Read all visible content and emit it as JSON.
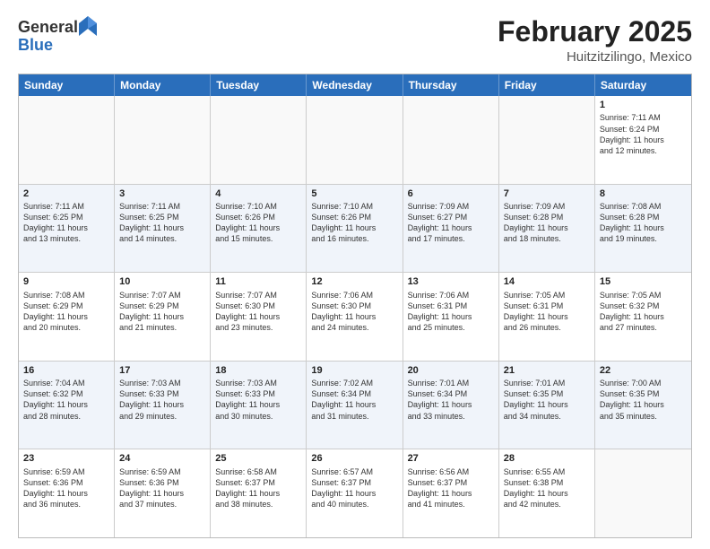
{
  "header": {
    "logo_line1": "General",
    "logo_line2": "Blue",
    "month_title": "February 2025",
    "location": "Huitzitzilingo, Mexico"
  },
  "days_of_week": [
    "Sunday",
    "Monday",
    "Tuesday",
    "Wednesday",
    "Thursday",
    "Friday",
    "Saturday"
  ],
  "weeks": [
    {
      "alt": false,
      "cells": [
        {
          "day": "",
          "empty": true,
          "lines": []
        },
        {
          "day": "",
          "empty": true,
          "lines": []
        },
        {
          "day": "",
          "empty": true,
          "lines": []
        },
        {
          "day": "",
          "empty": true,
          "lines": []
        },
        {
          "day": "",
          "empty": true,
          "lines": []
        },
        {
          "day": "",
          "empty": true,
          "lines": []
        },
        {
          "day": "1",
          "empty": false,
          "lines": [
            "Sunrise: 7:11 AM",
            "Sunset: 6:24 PM",
            "Daylight: 11 hours",
            "and 12 minutes."
          ]
        }
      ]
    },
    {
      "alt": true,
      "cells": [
        {
          "day": "2",
          "empty": false,
          "lines": [
            "Sunrise: 7:11 AM",
            "Sunset: 6:25 PM",
            "Daylight: 11 hours",
            "and 13 minutes."
          ]
        },
        {
          "day": "3",
          "empty": false,
          "lines": [
            "Sunrise: 7:11 AM",
            "Sunset: 6:25 PM",
            "Daylight: 11 hours",
            "and 14 minutes."
          ]
        },
        {
          "day": "4",
          "empty": false,
          "lines": [
            "Sunrise: 7:10 AM",
            "Sunset: 6:26 PM",
            "Daylight: 11 hours",
            "and 15 minutes."
          ]
        },
        {
          "day": "5",
          "empty": false,
          "lines": [
            "Sunrise: 7:10 AM",
            "Sunset: 6:26 PM",
            "Daylight: 11 hours",
            "and 16 minutes."
          ]
        },
        {
          "day": "6",
          "empty": false,
          "lines": [
            "Sunrise: 7:09 AM",
            "Sunset: 6:27 PM",
            "Daylight: 11 hours",
            "and 17 minutes."
          ]
        },
        {
          "day": "7",
          "empty": false,
          "lines": [
            "Sunrise: 7:09 AM",
            "Sunset: 6:28 PM",
            "Daylight: 11 hours",
            "and 18 minutes."
          ]
        },
        {
          "day": "8",
          "empty": false,
          "lines": [
            "Sunrise: 7:08 AM",
            "Sunset: 6:28 PM",
            "Daylight: 11 hours",
            "and 19 minutes."
          ]
        }
      ]
    },
    {
      "alt": false,
      "cells": [
        {
          "day": "9",
          "empty": false,
          "lines": [
            "Sunrise: 7:08 AM",
            "Sunset: 6:29 PM",
            "Daylight: 11 hours",
            "and 20 minutes."
          ]
        },
        {
          "day": "10",
          "empty": false,
          "lines": [
            "Sunrise: 7:07 AM",
            "Sunset: 6:29 PM",
            "Daylight: 11 hours",
            "and 21 minutes."
          ]
        },
        {
          "day": "11",
          "empty": false,
          "lines": [
            "Sunrise: 7:07 AM",
            "Sunset: 6:30 PM",
            "Daylight: 11 hours",
            "and 23 minutes."
          ]
        },
        {
          "day": "12",
          "empty": false,
          "lines": [
            "Sunrise: 7:06 AM",
            "Sunset: 6:30 PM",
            "Daylight: 11 hours",
            "and 24 minutes."
          ]
        },
        {
          "day": "13",
          "empty": false,
          "lines": [
            "Sunrise: 7:06 AM",
            "Sunset: 6:31 PM",
            "Daylight: 11 hours",
            "and 25 minutes."
          ]
        },
        {
          "day": "14",
          "empty": false,
          "lines": [
            "Sunrise: 7:05 AM",
            "Sunset: 6:31 PM",
            "Daylight: 11 hours",
            "and 26 minutes."
          ]
        },
        {
          "day": "15",
          "empty": false,
          "lines": [
            "Sunrise: 7:05 AM",
            "Sunset: 6:32 PM",
            "Daylight: 11 hours",
            "and 27 minutes."
          ]
        }
      ]
    },
    {
      "alt": true,
      "cells": [
        {
          "day": "16",
          "empty": false,
          "lines": [
            "Sunrise: 7:04 AM",
            "Sunset: 6:32 PM",
            "Daylight: 11 hours",
            "and 28 minutes."
          ]
        },
        {
          "day": "17",
          "empty": false,
          "lines": [
            "Sunrise: 7:03 AM",
            "Sunset: 6:33 PM",
            "Daylight: 11 hours",
            "and 29 minutes."
          ]
        },
        {
          "day": "18",
          "empty": false,
          "lines": [
            "Sunrise: 7:03 AM",
            "Sunset: 6:33 PM",
            "Daylight: 11 hours",
            "and 30 minutes."
          ]
        },
        {
          "day": "19",
          "empty": false,
          "lines": [
            "Sunrise: 7:02 AM",
            "Sunset: 6:34 PM",
            "Daylight: 11 hours",
            "and 31 minutes."
          ]
        },
        {
          "day": "20",
          "empty": false,
          "lines": [
            "Sunrise: 7:01 AM",
            "Sunset: 6:34 PM",
            "Daylight: 11 hours",
            "and 33 minutes."
          ]
        },
        {
          "day": "21",
          "empty": false,
          "lines": [
            "Sunrise: 7:01 AM",
            "Sunset: 6:35 PM",
            "Daylight: 11 hours",
            "and 34 minutes."
          ]
        },
        {
          "day": "22",
          "empty": false,
          "lines": [
            "Sunrise: 7:00 AM",
            "Sunset: 6:35 PM",
            "Daylight: 11 hours",
            "and 35 minutes."
          ]
        }
      ]
    },
    {
      "alt": false,
      "cells": [
        {
          "day": "23",
          "empty": false,
          "lines": [
            "Sunrise: 6:59 AM",
            "Sunset: 6:36 PM",
            "Daylight: 11 hours",
            "and 36 minutes."
          ]
        },
        {
          "day": "24",
          "empty": false,
          "lines": [
            "Sunrise: 6:59 AM",
            "Sunset: 6:36 PM",
            "Daylight: 11 hours",
            "and 37 minutes."
          ]
        },
        {
          "day": "25",
          "empty": false,
          "lines": [
            "Sunrise: 6:58 AM",
            "Sunset: 6:37 PM",
            "Daylight: 11 hours",
            "and 38 minutes."
          ]
        },
        {
          "day": "26",
          "empty": false,
          "lines": [
            "Sunrise: 6:57 AM",
            "Sunset: 6:37 PM",
            "Daylight: 11 hours",
            "and 40 minutes."
          ]
        },
        {
          "day": "27",
          "empty": false,
          "lines": [
            "Sunrise: 6:56 AM",
            "Sunset: 6:37 PM",
            "Daylight: 11 hours",
            "and 41 minutes."
          ]
        },
        {
          "day": "28",
          "empty": false,
          "lines": [
            "Sunrise: 6:55 AM",
            "Sunset: 6:38 PM",
            "Daylight: 11 hours",
            "and 42 minutes."
          ]
        },
        {
          "day": "",
          "empty": true,
          "lines": []
        }
      ]
    }
  ]
}
